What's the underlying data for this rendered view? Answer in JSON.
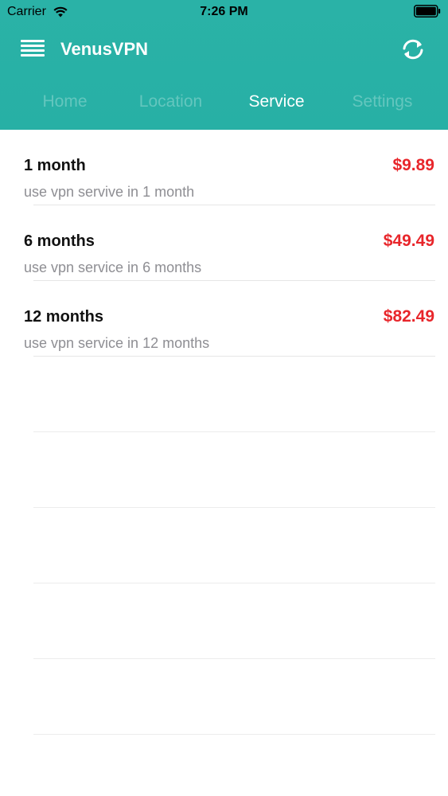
{
  "status_bar": {
    "carrier": "Carrier",
    "time": "7:26 PM",
    "wifi_icon": "wifi-icon",
    "battery_icon": "battery-icon"
  },
  "header": {
    "title": "VenusVPN",
    "menu_icon": "hamburger-menu-icon",
    "refresh_icon": "refresh-icon",
    "color": "#2bb3a8"
  },
  "tabs": [
    {
      "label": "Home",
      "active": false
    },
    {
      "label": "Location",
      "active": false
    },
    {
      "label": "Service",
      "active": true
    },
    {
      "label": "Settings",
      "active": false
    }
  ],
  "plans": [
    {
      "name": "1 month",
      "description": "use vpn servive in 1 month",
      "price": "$9.89"
    },
    {
      "name": "6 months",
      "description": "use vpn service in 6 months",
      "price": "$49.49"
    },
    {
      "name": "12 months",
      "description": "use vpn service in 12 months",
      "price": "$82.49"
    }
  ],
  "colors": {
    "accent": "#2bb3a8",
    "price": "#e8262b"
  }
}
